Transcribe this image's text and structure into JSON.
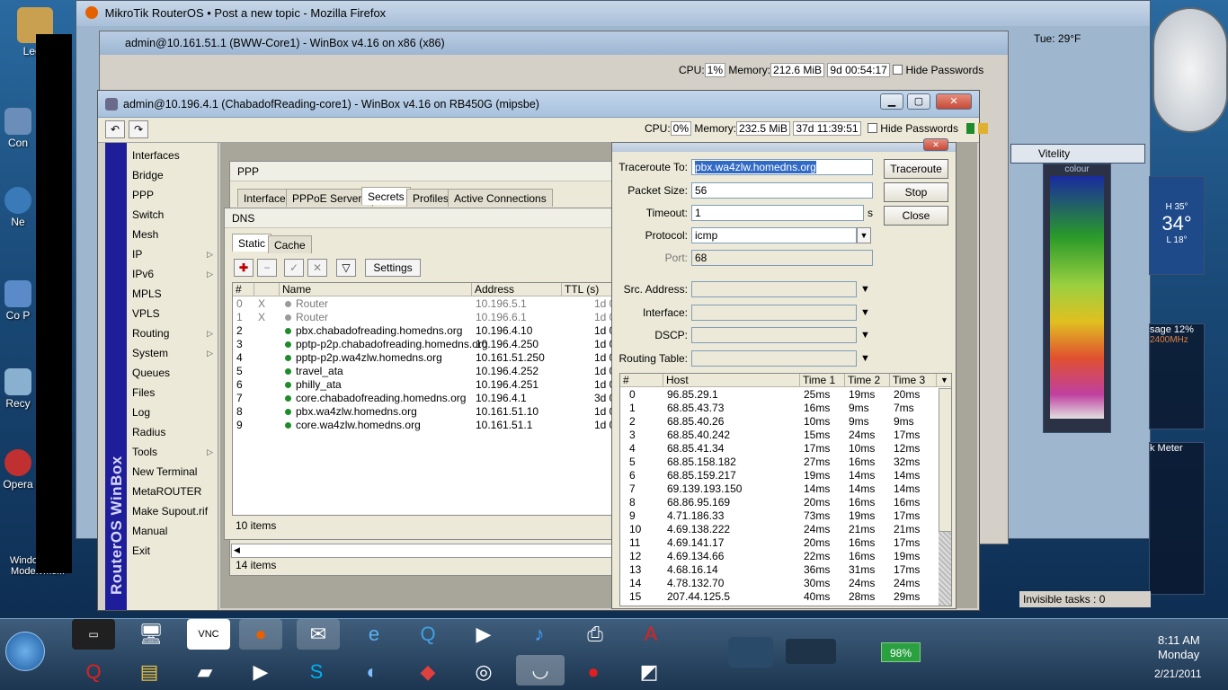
{
  "desktop": {
    "icons": [
      {
        "label": "Leon"
      },
      {
        "label": "Con"
      },
      {
        "label": "Ne"
      },
      {
        "label": "Co P"
      },
      {
        "label": "Recy"
      },
      {
        "label": "Opera"
      },
      {
        "label": "Windows XP Mode.vmc..."
      }
    ],
    "weather": {
      "day": "Tue: 29°F"
    }
  },
  "firefox": {
    "title": "MikroTik RouterOS • Post a new topic - Mozilla Firefox"
  },
  "winbox_back": {
    "title": "admin@10.161.51.1 (BWW-Core1) - WinBox v4.16 on x86 (x86)",
    "cpu_label": "CPU:",
    "cpu": "1%",
    "mem_label": "Memory:",
    "mem": "212.6 MiB",
    "uptime": "9d 00:54:17",
    "hide_pw": "Hide Passwords"
  },
  "winbox": {
    "title": "admin@10.196.4.1 (ChabadofReading-core1) - WinBox v4.16 on RB450G (mipsbe)",
    "cpu_label": "CPU:",
    "cpu": "0%",
    "mem_label": "Memory:",
    "mem": "232.5 MiB",
    "uptime": "37d 11:39:51",
    "hide_pw": "Hide Passwords",
    "sidebar_text": "RouterOS WinBox",
    "menu": [
      {
        "label": "Interfaces",
        "arrow": ""
      },
      {
        "label": "Bridge",
        "arrow": ""
      },
      {
        "label": "PPP",
        "arrow": ""
      },
      {
        "label": "Switch",
        "arrow": ""
      },
      {
        "label": "Mesh",
        "arrow": ""
      },
      {
        "label": "IP",
        "arrow": "▷"
      },
      {
        "label": "IPv6",
        "arrow": "▷"
      },
      {
        "label": "MPLS",
        "arrow": ""
      },
      {
        "label": "VPLS",
        "arrow": ""
      },
      {
        "label": "Routing",
        "arrow": "▷"
      },
      {
        "label": "System",
        "arrow": "▷"
      },
      {
        "label": "Queues",
        "arrow": ""
      },
      {
        "label": "Files",
        "arrow": ""
      },
      {
        "label": "Log",
        "arrow": ""
      },
      {
        "label": "Radius",
        "arrow": ""
      },
      {
        "label": "Tools",
        "arrow": "▷"
      },
      {
        "label": "New Terminal",
        "arrow": ""
      },
      {
        "label": "MetaROUTER",
        "arrow": ""
      },
      {
        "label": "Make Supout.rif",
        "arrow": ""
      },
      {
        "label": "Manual",
        "arrow": ""
      },
      {
        "label": "Exit",
        "arrow": ""
      }
    ]
  },
  "ppp": {
    "title": "PPP",
    "tabs": [
      "Interface",
      "PPPoE Servers",
      "Secrets",
      "Profiles",
      "Active Connections"
    ],
    "status": "14 items"
  },
  "dns": {
    "title": "DNS",
    "tabs": [
      "Static",
      "Cache"
    ],
    "settings_label": "Settings",
    "columns": [
      "#",
      "Name",
      "Address",
      "TTL (s)"
    ],
    "rows": [
      {
        "num": "0",
        "flag": "X",
        "name": "Router",
        "address": "10.196.5.1",
        "ttl": "1d 0",
        "enabled": false
      },
      {
        "num": "1",
        "flag": "X",
        "name": "Router",
        "address": "10.196.6.1",
        "ttl": "1d 0",
        "enabled": false
      },
      {
        "num": "2",
        "flag": "",
        "name": "pbx.chabadofreading.homedns.org",
        "address": "10.196.4.10",
        "ttl": "1d 0",
        "enabled": true
      },
      {
        "num": "3",
        "flag": "",
        "name": "pptp-p2p.chabadofreading.homedns.org",
        "address": "10.196.4.250",
        "ttl": "1d 0",
        "enabled": true
      },
      {
        "num": "4",
        "flag": "",
        "name": "pptp-p2p.wa4zlw.homedns.org",
        "address": "10.161.51.250",
        "ttl": "1d 0",
        "enabled": true
      },
      {
        "num": "5",
        "flag": "",
        "name": "travel_ata",
        "address": "10.196.4.252",
        "ttl": "1d 0",
        "enabled": true
      },
      {
        "num": "6",
        "flag": "",
        "name": "philly_ata",
        "address": "10.196.4.251",
        "ttl": "1d 0",
        "enabled": true
      },
      {
        "num": "7",
        "flag": "",
        "name": "core.chabadofreading.homedns.org",
        "address": "10.196.4.1",
        "ttl": "3d 0",
        "enabled": true
      },
      {
        "num": "8",
        "flag": "",
        "name": "pbx.wa4zlw.homedns.org",
        "address": "10.161.51.10",
        "ttl": "1d 0",
        "enabled": true
      },
      {
        "num": "9",
        "flag": "",
        "name": "core.wa4zlw.homedns.org",
        "address": "10.161.51.1",
        "ttl": "1d 0",
        "enabled": true
      }
    ],
    "status": "10 items"
  },
  "traceroute": {
    "title": "Traceroute",
    "fields": {
      "to_label": "Traceroute To:",
      "to_value": "pbx.wa4zlw.homedns.org",
      "size_label": "Packet Size:",
      "size_value": "56",
      "timeout_label": "Timeout:",
      "timeout_value": "1",
      "timeout_unit": "s",
      "protocol_label": "Protocol:",
      "protocol_value": "icmp",
      "port_label": "Port:",
      "port_value": "68",
      "src_label": "Src. Address:",
      "iface_label": "Interface:",
      "dscp_label": "DSCP:",
      "rt_label": "Routing Table:"
    },
    "buttons": {
      "start": "Traceroute",
      "stop": "Stop",
      "close": "Close"
    },
    "columns": [
      "#",
      "Host",
      "Time 1",
      "Time 2",
      "Time 3"
    ],
    "hops": [
      {
        "n": "0",
        "host": "96.85.29.1",
        "t1": "25ms",
        "t2": "19ms",
        "t3": "20ms"
      },
      {
        "n": "1",
        "host": "68.85.43.73",
        "t1": "16ms",
        "t2": "9ms",
        "t3": "7ms"
      },
      {
        "n": "2",
        "host": "68.85.40.26",
        "t1": "10ms",
        "t2": "9ms",
        "t3": "9ms"
      },
      {
        "n": "3",
        "host": "68.85.40.242",
        "t1": "15ms",
        "t2": "24ms",
        "t3": "17ms"
      },
      {
        "n": "4",
        "host": "68.85.41.34",
        "t1": "17ms",
        "t2": "10ms",
        "t3": "12ms"
      },
      {
        "n": "5",
        "host": "68.85.158.182",
        "t1": "27ms",
        "t2": "16ms",
        "t3": "32ms"
      },
      {
        "n": "6",
        "host": "68.85.159.217",
        "t1": "19ms",
        "t2": "14ms",
        "t3": "14ms"
      },
      {
        "n": "7",
        "host": "69.139.193.150",
        "t1": "14ms",
        "t2": "14ms",
        "t3": "14ms"
      },
      {
        "n": "8",
        "host": "68.86.95.169",
        "t1": "20ms",
        "t2": "16ms",
        "t3": "16ms"
      },
      {
        "n": "9",
        "host": "4.71.186.33",
        "t1": "73ms",
        "t2": "19ms",
        "t3": "17ms"
      },
      {
        "n": "10",
        "host": "4.69.138.222",
        "t1": "24ms",
        "t2": "21ms",
        "t3": "21ms"
      },
      {
        "n": "11",
        "host": "4.69.141.17",
        "t1": "20ms",
        "t2": "16ms",
        "t3": "17ms"
      },
      {
        "n": "12",
        "host": "4.69.134.66",
        "t1": "22ms",
        "t2": "16ms",
        "t3": "19ms"
      },
      {
        "n": "13",
        "host": "4.68.16.14",
        "t1": "36ms",
        "t2": "31ms",
        "t3": "17ms"
      },
      {
        "n": "14",
        "host": "4.78.132.70",
        "t1": "30ms",
        "t2": "24ms",
        "t3": "24ms"
      },
      {
        "n": "15",
        "host": "207.44.125.5",
        "t1": "40ms",
        "t2": "28ms",
        "t3": "29ms"
      }
    ]
  },
  "gadgets": {
    "vitelity": "Vitelity",
    "colour": "colour",
    "temp": "34°",
    "temp_hi": "H 35°",
    "temp_lo": "L 18°",
    "cpu_usage": "sage 12%",
    "cpu_clock": "2400MHz",
    "net_meter": "k Meter",
    "invisible_tasks": "Invisible tasks : 0"
  },
  "taskbar": {
    "battery": "98%",
    "time": "8:11 AM",
    "day": "Monday",
    "date": "2/21/2011"
  },
  "colors": {
    "accent": "#1e1e9a",
    "enabled_dot": "#1e8c2a"
  }
}
